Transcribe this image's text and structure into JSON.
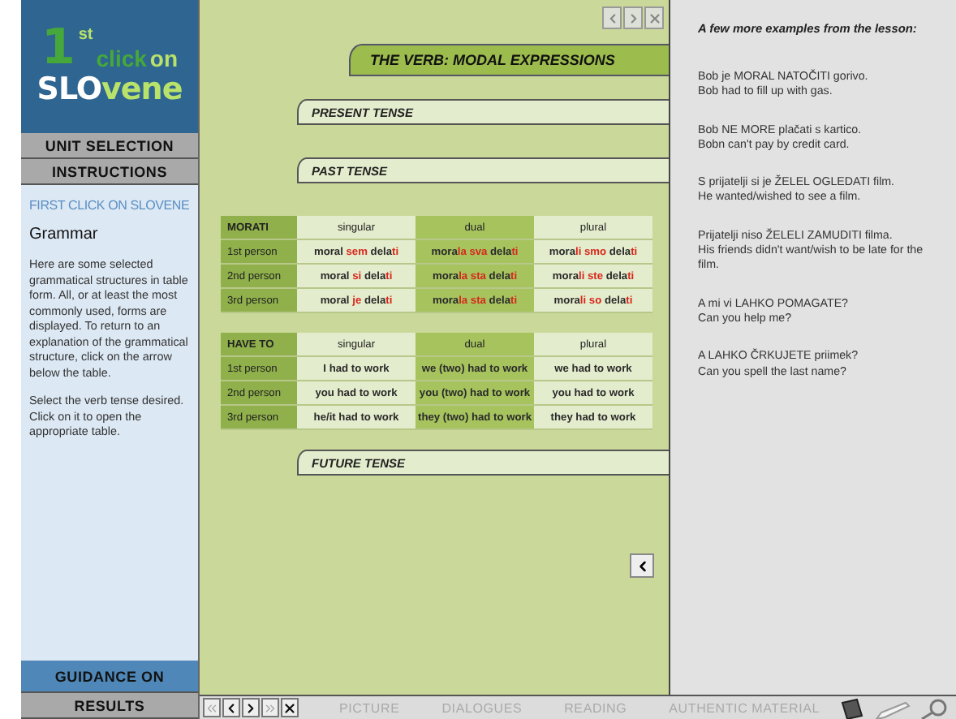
{
  "logo": {
    "number": "1",
    "suffix": "st",
    "click": "click",
    "on": "on",
    "slo": "SLO",
    "vene": "vene"
  },
  "menu_top": [
    "UNIT SELECTION",
    "INSTRUCTIONS"
  ],
  "instructions": {
    "heading": "FIRST CLICK ON SLOVENE",
    "title": "Grammar",
    "paragraphs": [
      "Here are some selected grammatical structures in table form. All, or at least the most commonly used, forms are displayed. To return to an explanation of the grammatical structure, click on the arrow below the table.",
      "Select the verb tense desired. Click on it to open the appropriate table."
    ]
  },
  "menu_bottom": [
    {
      "label": "GUIDANCE ON",
      "selected": true
    },
    {
      "label": "RESULTS",
      "selected": false
    }
  ],
  "window_controls": [
    {
      "kind": "prev"
    },
    {
      "kind": "next"
    },
    {
      "kind": "close"
    }
  ],
  "title": "THE VERB: MODAL EXPRESSIONS",
  "sections": [
    {
      "kind": "header",
      "label": "PRESENT TENSE"
    },
    {
      "kind": "header",
      "label": "PAST TENSE"
    },
    {
      "kind": "table",
      "header": "MORATI",
      "columns": [
        "singular",
        "dual",
        "plural"
      ],
      "rows": [
        {
          "label": "1st person",
          "cells": [
            [
              {
                "text": "moral",
                "highlight": false
              },
              {
                "text": " sem ",
                "highlight": true
              },
              {
                "text": "dela",
                "highlight": false
              },
              {
                "text": "ti",
                "highlight": true
              }
            ],
            [
              {
                "text": "mora",
                "highlight": false
              },
              {
                "text": "la sva ",
                "highlight": true
              },
              {
                "text": "dela",
                "highlight": false
              },
              {
                "text": "ti",
                "highlight": true
              }
            ],
            [
              {
                "text": "mora",
                "highlight": false
              },
              {
                "text": "li smo ",
                "highlight": true
              },
              {
                "text": "dela",
                "highlight": false
              },
              {
                "text": "ti",
                "highlight": true
              }
            ]
          ]
        },
        {
          "label": "2nd person",
          "cells": [
            [
              {
                "text": "moral",
                "highlight": false
              },
              {
                "text": " si ",
                "highlight": true
              },
              {
                "text": "dela",
                "highlight": false
              },
              {
                "text": "ti",
                "highlight": true
              }
            ],
            [
              {
                "text": "mora",
                "highlight": false
              },
              {
                "text": "la sta ",
                "highlight": true
              },
              {
                "text": "dela",
                "highlight": false
              },
              {
                "text": "ti",
                "highlight": true
              }
            ],
            [
              {
                "text": "mora",
                "highlight": false
              },
              {
                "text": "li ste ",
                "highlight": true
              },
              {
                "text": "dela",
                "highlight": false
              },
              {
                "text": "ti",
                "highlight": true
              }
            ]
          ]
        },
        {
          "label": "3rd person",
          "cells": [
            [
              {
                "text": "moral",
                "highlight": false
              },
              {
                "text": " je ",
                "highlight": true
              },
              {
                "text": "dela",
                "highlight": false
              },
              {
                "text": "ti",
                "highlight": true
              }
            ],
            [
              {
                "text": "mora",
                "highlight": false
              },
              {
                "text": "la sta ",
                "highlight": true
              },
              {
                "text": "dela",
                "highlight": false
              },
              {
                "text": "ti",
                "highlight": true
              }
            ],
            [
              {
                "text": "mora",
                "highlight": false
              },
              {
                "text": "li so ",
                "highlight": true
              },
              {
                "text": "dela",
                "highlight": false
              },
              {
                "text": "ti",
                "highlight": true
              }
            ]
          ]
        }
      ]
    },
    {
      "kind": "table",
      "header": "HAVE TO",
      "columns": [
        "singular",
        "dual",
        "plural"
      ],
      "rows": [
        {
          "label": "1st person",
          "cells": [
            [
              {
                "text": "I had to work",
                "highlight": false
              }
            ],
            [
              {
                "text": "we (two) had to work",
                "highlight": false
              }
            ],
            [
              {
                "text": "we had to work",
                "highlight": false
              }
            ]
          ]
        },
        {
          "label": "2nd person",
          "cells": [
            [
              {
                "text": "you had to work",
                "highlight": false
              }
            ],
            [
              {
                "text": "you (two) had to work",
                "highlight": false
              }
            ],
            [
              {
                "text": "you had to work",
                "highlight": false
              }
            ]
          ]
        },
        {
          "label": "3rd person",
          "cells": [
            [
              {
                "text": "he/it had to work",
                "highlight": false
              }
            ],
            [
              {
                "text": "they (two) had to work",
                "highlight": false
              }
            ],
            [
              {
                "text": "they had to work",
                "highlight": false
              }
            ]
          ]
        }
      ]
    },
    {
      "kind": "header",
      "label": "FUTURE TENSE"
    }
  ],
  "examples": {
    "heading": "A few more examples from the lesson:",
    "items": [
      {
        "slovene": "Bob je MORAL NATOČITI gorivo.",
        "english": "Bob had to fill up with gas."
      },
      {
        "slovene": "Bob NE MORE plačati s kartico.",
        "english": "Bobn can't pay by credit card."
      },
      {
        "slovene": "S prijatelji si je ŽELEL OGLEDATI film.",
        "english": "He wanted/wished to see a film."
      },
      {
        "slovene": "Prijatelji niso ŽELELI ZAMUDITI filma.",
        "english": "His friends didn't want/wish to be late for the film."
      },
      {
        "slovene": "A mi vi LAHKO POMAGATE?",
        "english": "Can you help me?"
      },
      {
        "slovene": "A LAHKO ČRKUJETE priimek?",
        "english": "Can you spell the last name?"
      }
    ]
  },
  "bottom_nav": [
    {
      "kind": "first",
      "disabled": true
    },
    {
      "kind": "prev",
      "disabled": false
    },
    {
      "kind": "next",
      "disabled": false
    },
    {
      "kind": "last",
      "disabled": true
    },
    {
      "kind": "close",
      "disabled": false
    }
  ],
  "bottom_tabs": [
    "PICTURE",
    "DIALOGUES",
    "READING",
    "AUTHENTIC MATERIAL"
  ]
}
